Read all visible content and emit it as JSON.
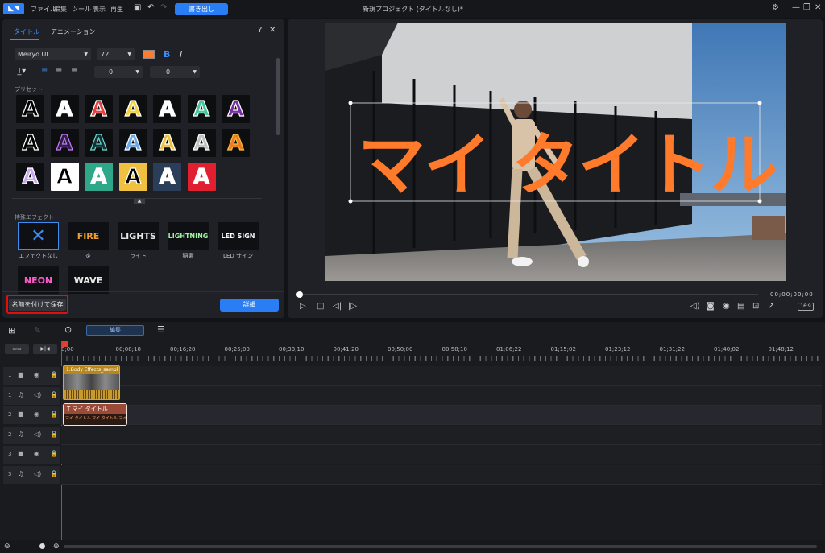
{
  "app": {
    "logo": "CyberLink",
    "menu": [
      "ファイル",
      "編集",
      "ツール",
      "表示",
      "再生"
    ],
    "export_label": "書き出し",
    "window_title": "新規プロジェクト (タイトルなし)*"
  },
  "title_panel": {
    "tabs": [
      "タイトル",
      "アニメーション"
    ],
    "help": "?",
    "close": "✕",
    "font": "Meiryo UI",
    "size": "72",
    "bold": "B",
    "italic": "I",
    "spacing1": "0",
    "spacing2": "0",
    "preset_label": "プリセット",
    "presets": [
      {
        "glyph": "A",
        "fg": "#000000",
        "stroke": "#ffffff",
        "bg": "#0d0e10"
      },
      {
        "glyph": "A",
        "fg": "#ffffff",
        "stroke": "#ffffff",
        "bg": "#0d0e10"
      },
      {
        "glyph": "A",
        "fg": "#e84040",
        "stroke": "#ffffff",
        "bg": "#0d0e10"
      },
      {
        "glyph": "A",
        "fg": "#f5d23a",
        "stroke": "#ffffff",
        "bg": "#0d0e10"
      },
      {
        "glyph": "A",
        "fg": "#ffffff",
        "stroke": "#ffffff",
        "bg": "#0d0e10"
      },
      {
        "glyph": "A",
        "fg": "#45c79a",
        "stroke": "#ffffff",
        "bg": "#0d0e10"
      },
      {
        "glyph": "A",
        "fg": "#7a2ea8",
        "stroke": "#ffffff",
        "bg": "#0d0e10"
      },
      {
        "glyph": "A",
        "fg": "#000000",
        "stroke": "#ffffff",
        "bg": "#0d0e10"
      },
      {
        "glyph": "A",
        "fg": "#2a2040",
        "stroke": "#c87aff",
        "bg": "#0d0e10"
      },
      {
        "glyph": "A",
        "fg": "#1c2d30",
        "stroke": "#62d9d0",
        "bg": "#0d0e10"
      },
      {
        "glyph": "A",
        "fg": "#6aa9e8",
        "stroke": "#ffffff",
        "bg": "#0d0e10"
      },
      {
        "glyph": "A",
        "fg": "#f0c040",
        "stroke": "#ffffff",
        "bg": "#0d0e10"
      },
      {
        "glyph": "A",
        "fg": "#c0c0c0",
        "stroke": "#ffffff",
        "bg": "#0d0e10"
      },
      {
        "glyph": "A",
        "fg": "#f07a20",
        "stroke": "#f0c040",
        "bg": "#0d0e10"
      },
      {
        "glyph": "A",
        "fg": "#c8a6f0",
        "stroke": "#ffffff",
        "bg": "#0d0e10"
      },
      {
        "glyph": "A",
        "fg": "#000000",
        "stroke": "#ffffff",
        "bg": "#ffffff"
      },
      {
        "glyph": "A",
        "fg": "#ffffff",
        "stroke": "#ffffff",
        "bg": "#2fa88a"
      },
      {
        "glyph": "A",
        "fg": "#000000",
        "stroke": "#ffffff",
        "bg": "#f0c040"
      },
      {
        "glyph": "A",
        "fg": "#ffffff",
        "stroke": "#ffffff",
        "bg": "#2a3e5a"
      },
      {
        "glyph": "A",
        "fg": "#ffffff",
        "stroke": "#ffffff",
        "bg": "#e02030"
      }
    ],
    "effects_label": "特殊エフェクト",
    "effects": [
      {
        "thumb": "",
        "label": "エフェクトなし",
        "color": "#3d8ef0"
      },
      {
        "thumb": "FIRE",
        "label": "炎",
        "color": "#f0a030"
      },
      {
        "thumb": "LIGHTS",
        "label": "ライト",
        "color": "#e8e8e8"
      },
      {
        "thumb": "LIGHTNING",
        "label": "稲妻",
        "color": "#9ff0a0"
      },
      {
        "thumb": "LED SIGN",
        "label": "LED サイン",
        "color": "#ffffff"
      },
      {
        "thumb": "NEON",
        "label": "",
        "color": "#ff5ad0"
      },
      {
        "thumb": "WAVE",
        "label": "",
        "color": "#e8e8e8"
      }
    ],
    "save_as_label": "名前を付けて保存",
    "detail_label": "詳細"
  },
  "preview": {
    "title_text": "マイ タイトル",
    "timecode": "00;00;00;00",
    "aspect": "16:9",
    "title_color": "#ff7a2a"
  },
  "timeline": {
    "edit_label": "編集",
    "ruler": [
      "0;00",
      "00;08;10",
      "00;16;20",
      "00;25;00",
      "00;33;10",
      "00;41;20",
      "00;50;00",
      "00;58;10",
      "01;06;22",
      "01;15;02",
      "01;23;12",
      "01;31;22",
      "01;40;02",
      "01;48;12"
    ],
    "tracks": [
      "1",
      "1",
      "2",
      "2",
      "3",
      "3"
    ],
    "video_clip": "1.Body Effects_sampl",
    "title_clip": "マイ タイトル",
    "title_clip_sub": "マイ タイトル  マイ タイトル  マイ タイトル"
  }
}
